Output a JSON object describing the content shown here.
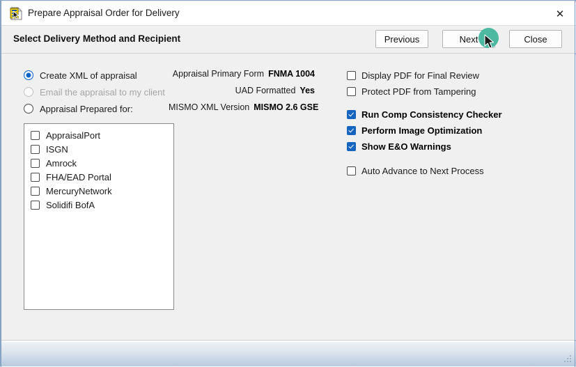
{
  "window": {
    "title": "Prepare Appraisal Order for Delivery",
    "icon": "appraisal-document-icon",
    "close_glyph": "✕"
  },
  "header": {
    "title": "Select Delivery Method and Recipient"
  },
  "nav_buttons": [
    {
      "label": "Previous",
      "name": "previous-button"
    },
    {
      "label": "Next",
      "name": "next-button"
    },
    {
      "label": "Close",
      "name": "close-button"
    }
  ],
  "delivery_method": {
    "options": [
      {
        "label": "Create XML of appraisal",
        "selected": true,
        "disabled": false
      },
      {
        "label": "Email the appraisal to my client",
        "selected": false,
        "disabled": true
      },
      {
        "label": "Appraisal Prepared for:",
        "selected": false,
        "disabled": false
      }
    ]
  },
  "recipients": {
    "items": [
      {
        "label": "AppraisalPort",
        "checked": false
      },
      {
        "label": "ISGN",
        "checked": false
      },
      {
        "label": "Amrock",
        "checked": false
      },
      {
        "label": "FHA/EAD Portal",
        "checked": false
      },
      {
        "label": "MercuryNetwork",
        "checked": false
      },
      {
        "label": "Solidifi BofA",
        "checked": false
      }
    ]
  },
  "appraisal_info": [
    {
      "label": "Appraisal Primary Form",
      "value": "FNMA 1004"
    },
    {
      "label": "UAD Formatted",
      "value": "Yes"
    },
    {
      "label": "MISMO XML Version",
      "value": "MISMO 2.6 GSE"
    }
  ],
  "options": [
    {
      "label": "Display PDF for Final Review",
      "checked": false
    },
    {
      "label": "Protect PDF from Tampering",
      "checked": false
    },
    {
      "label": "Run Comp Consistency Checker",
      "checked": true
    },
    {
      "label": "Perform Image Optimization",
      "checked": true
    },
    {
      "label": "Show E&O Warnings",
      "checked": true
    },
    {
      "label": "Auto Advance to Next Process",
      "checked": false
    }
  ],
  "colors": {
    "accent_blue": "#1565c0",
    "radio_blue": "#0b64c8",
    "cursor_highlight": "#4cb9a0",
    "window_bg": "#f0f0f0",
    "frame_border": "#7f9dc0"
  }
}
